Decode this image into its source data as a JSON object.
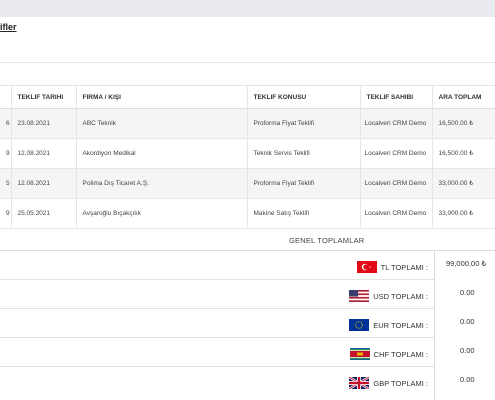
{
  "page": {
    "link_text": "ifler"
  },
  "table": {
    "headers": [
      "",
      "TEKLIF TARIHI",
      "FIRMA / KIŞI",
      "TEKLIF KONUSU",
      "TEKLIF SAHIBI",
      "ARA TOPLAM"
    ],
    "rows": [
      {
        "no": "6",
        "date": "23.08.2021",
        "company": "ABC Teknik",
        "subject": "Proforma Fiyat Teklifi",
        "owner": "Localveri CRM Demo",
        "amount": "16,500.00 ₺"
      },
      {
        "no": "9",
        "date": "12.08.2021",
        "company": "Akordiyon Medikal",
        "subject": "Teknik Servis Teklifi",
        "owner": "Localveri CRM Demo",
        "amount": "16,500.00 ₺"
      },
      {
        "no": "5",
        "date": "12.08.2021",
        "company": "Polima Dış Ticaret A.Ş.",
        "subject": "Proforma Fiyat Teklifi",
        "owner": "Localveri CRM Demo",
        "amount": "33,000.00 ₺"
      },
      {
        "no": "9",
        "date": "25.05.2021",
        "company": "Avşaroğlu Bıçakçılık",
        "subject": "Makine Satış Teklifi",
        "owner": "Localveri CRM Demo",
        "amount": "33,000.00 ₺"
      }
    ]
  },
  "totals": {
    "title": "GENEL TOPLAMLAR",
    "rows": [
      {
        "flag": "turkey-flag-icon",
        "label": "TL TOPLAMI :",
        "value": "99,000.00 ₺"
      },
      {
        "flag": "usa-flag-icon",
        "label": "USD TOPLAMI :",
        "value": "0.00"
      },
      {
        "flag": "eu-flag-icon",
        "label": "EUR TOPLAMI :",
        "value": "0.00"
      },
      {
        "flag": "swiss-flag-icon",
        "label": "CHF TOPLAMI :",
        "value": "0.00"
      },
      {
        "flag": "uk-flag-icon",
        "label": "GBP TOPLAMI :",
        "value": "0.00"
      }
    ]
  },
  "colors": {
    "zebra": "#f5f5f5",
    "border": "#e3e3e3",
    "topbar": "#e9ebee"
  }
}
